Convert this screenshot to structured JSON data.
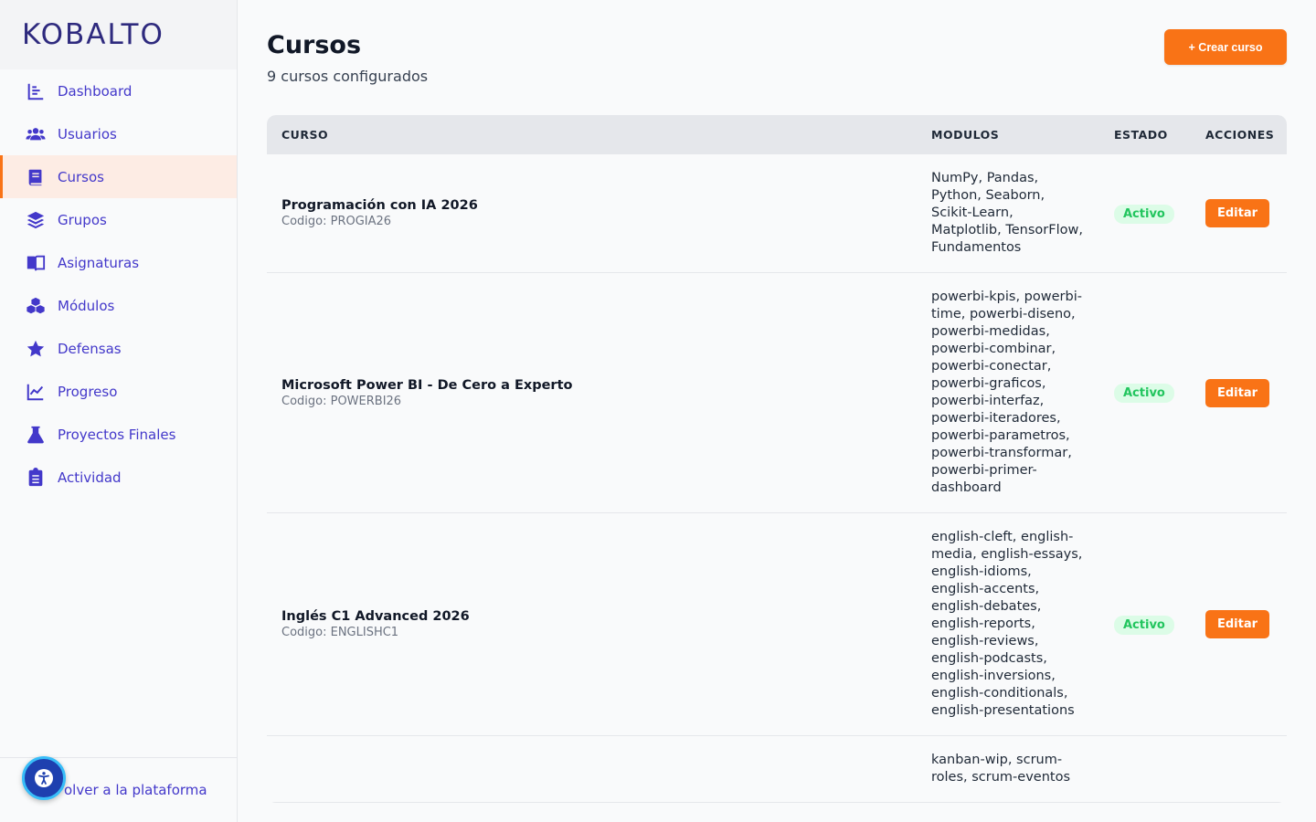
{
  "brand": {
    "logo": "KOBALTO"
  },
  "sidebar": {
    "items": [
      {
        "label": "Dashboard",
        "icon": "dashboard-icon",
        "active": false
      },
      {
        "label": "Usuarios",
        "icon": "users-icon",
        "active": false
      },
      {
        "label": "Cursos",
        "icon": "book-icon",
        "active": true
      },
      {
        "label": "Grupos",
        "icon": "layers-icon",
        "active": false
      },
      {
        "label": "Asignaturas",
        "icon": "open-book-icon",
        "active": false
      },
      {
        "label": "Módulos",
        "icon": "cubes-icon",
        "active": false
      },
      {
        "label": "Defensas",
        "icon": "star-icon",
        "active": false
      },
      {
        "label": "Progreso",
        "icon": "line-chart-icon",
        "active": false
      },
      {
        "label": "Proyectos Finales",
        "icon": "flask-icon",
        "active": false
      },
      {
        "label": "Actividad",
        "icon": "clipboard-icon",
        "active": false
      }
    ],
    "footer_link": "olver a la plataforma"
  },
  "header": {
    "title": "Cursos",
    "subtitle": "9 cursos configurados",
    "create_button": "+ Crear curso"
  },
  "table": {
    "columns": [
      "CURSO",
      "MODULOS",
      "ESTADO",
      "ACCIONES"
    ],
    "rows": [
      {
        "name": "Programación con IA 2026",
        "code": "Codigo: PROGIA26",
        "modules": "NumPy, Pandas, Python, Seaborn, Scikit-Learn, Matplotlib, TensorFlow, Fundamentos",
        "status": "Activo",
        "action": "Editar"
      },
      {
        "name": "Microsoft Power BI - De Cero a Experto",
        "code": "Codigo: POWERBI26",
        "modules": "powerbi-kpis, powerbi-time, powerbi-diseno, powerbi-medidas, powerbi-combinar, powerbi-conectar, powerbi-graficos, powerbi-interfaz, powerbi-iteradores, powerbi-parametros, powerbi-transformar, powerbi-primer-dashboard",
        "status": "Activo",
        "action": "Editar"
      },
      {
        "name": "Inglés C1 Advanced 2026",
        "code": "Codigo: ENGLISHC1",
        "modules": "english-cleft, english-media, english-essays, english-idioms, english-accents, english-debates, english-reports, english-reviews, english-podcasts, english-inversions, english-conditionals, english-presentations",
        "status": "Activo",
        "action": "Editar"
      },
      {
        "name": "",
        "code": "",
        "modules": "kanban-wip, scrum-roles, scrum-eventos",
        "status": "",
        "action": ""
      }
    ]
  },
  "colors": {
    "accent": "#f97316",
    "primary": "#4338ca",
    "success": "#22c55e"
  }
}
